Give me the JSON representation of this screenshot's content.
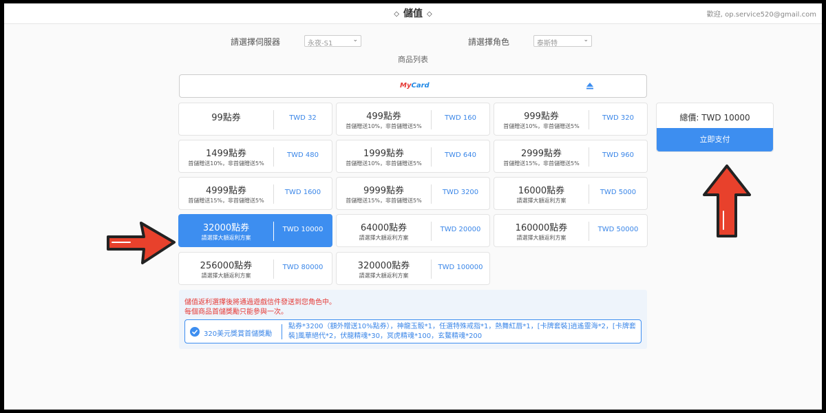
{
  "header": {
    "title": "儲值",
    "welcome": "歡迎, op.service520@gmail.com"
  },
  "selectors": {
    "server_label": "請選擇伺服器",
    "server_value": "永夜-S1",
    "role_label": "請選擇角色",
    "role_value": "泰斯特"
  },
  "product_list_title": "商品列表",
  "payment_method": {
    "logo_my": "My",
    "logo_card": "Card"
  },
  "products": [
    {
      "points": "99點券",
      "note": "",
      "price": "TWD 32"
    },
    {
      "points": "499點券",
      "note": "首儲贈送10%，非首儲贈送5%",
      "price": "TWD 160"
    },
    {
      "points": "999點券",
      "note": "首儲贈送10%，非首儲贈送5%",
      "price": "TWD 320"
    },
    {
      "points": "1499點券",
      "note": "首儲贈送10%，非首儲贈送5%",
      "price": "TWD 480"
    },
    {
      "points": "1999點券",
      "note": "首儲贈送10%，非首儲贈送5%",
      "price": "TWD 640"
    },
    {
      "points": "2999點券",
      "note": "首儲贈送15%，非首儲贈送5%",
      "price": "TWD 960"
    },
    {
      "points": "4999點券",
      "note": "首儲贈送15%，非首儲贈送5%",
      "price": "TWD 1600"
    },
    {
      "points": "9999點券",
      "note": "首儲贈送15%，非首儲贈送5%",
      "price": "TWD 3200"
    },
    {
      "points": "16000點券",
      "note": "請選擇大額返利方案",
      "price": "TWD 5000"
    },
    {
      "points": "32000點券",
      "note": "請選擇大額返利方案",
      "price": "TWD 10000",
      "selected": true
    },
    {
      "points": "64000點券",
      "note": "請選擇大額返利方案",
      "price": "TWD 20000"
    },
    {
      "points": "160000點券",
      "note": "請選擇大額返利方案",
      "price": "TWD 50000"
    },
    {
      "points": "256000點券",
      "note": "請選擇大額返利方案",
      "price": "TWD 80000"
    },
    {
      "points": "320000點券",
      "note": "請選擇大額返利方案",
      "price": "TWD 100000"
    }
  ],
  "summary": {
    "total": "總價: TWD 10000",
    "pay_button": "立即支付"
  },
  "notice": {
    "line1": "儲值返利選擇後將通過遊戲信件發送到您角色中。",
    "line2": "每個商品首儲獎勵只能參與一次。",
    "promo_name": "320美元獎賞首儲獎勵",
    "promo_desc": "點券*3200（額外贈送10%點券），神龍玉骰*1，任選特殊戒指*1，熱舞紅唇*1，[卡牌套裝]逍遙靈海*2，[卡牌套裝]風華絕代*2，伏龍精魂*30，冥虎精魂*100，玄鰲精魂*200"
  },
  "colors": {
    "accent": "#3d8ef0",
    "price_text": "#3a86e8",
    "notice_red": "#e53935",
    "arrow_red": "#e8412c"
  }
}
